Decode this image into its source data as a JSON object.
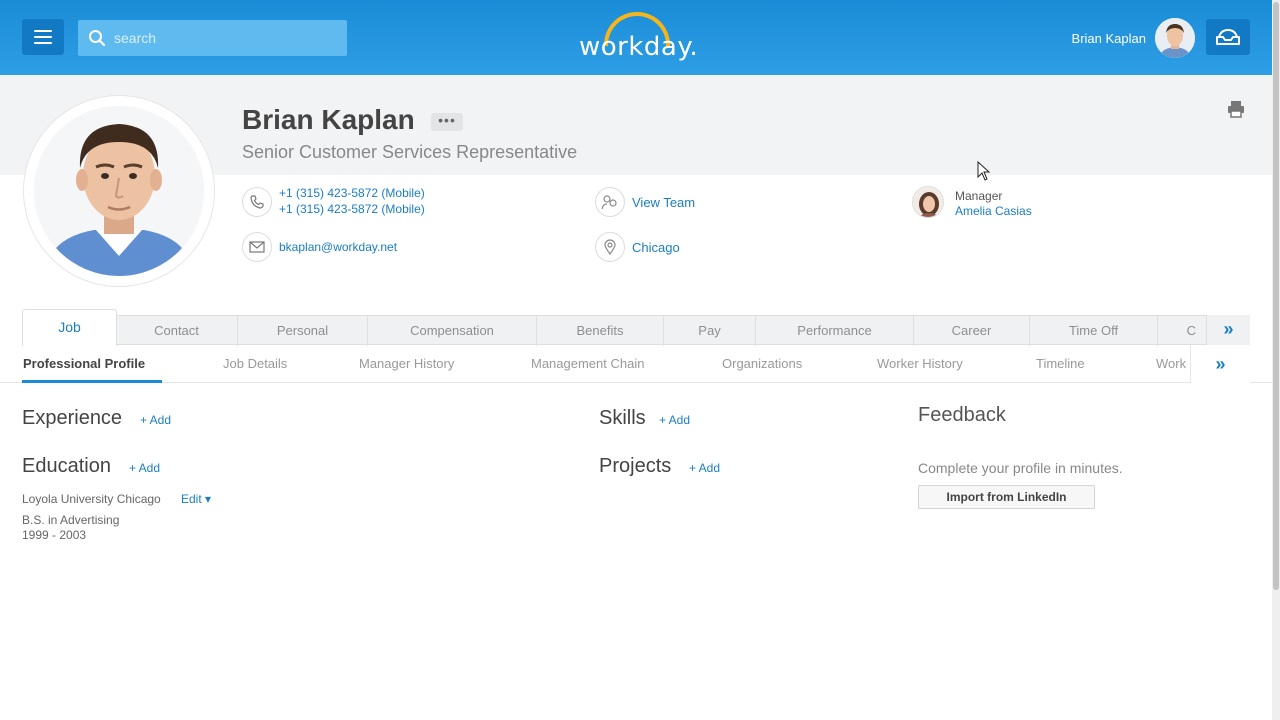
{
  "topbar": {
    "search_placeholder": "search",
    "logo_text": "workday.",
    "user_name": "Brian Kaplan"
  },
  "profile": {
    "name": "Brian Kaplan",
    "more_label": "•••",
    "job_title": "Senior Customer Services Representative",
    "phone_1": "+1 (315) 423-5872 (Mobile)",
    "phone_2": "+1 (315) 423-5872 (Mobile)",
    "email": "bkaplan@workday.net",
    "view_team": "View Team",
    "location": "Chicago",
    "manager_label": "Manager",
    "manager_name": "Amelia Casias"
  },
  "tabs": {
    "active": "Job",
    "items": [
      "Contact",
      "Personal",
      "Compensation",
      "Benefits",
      "Pay",
      "Performance",
      "Career",
      "Time Off",
      "C"
    ],
    "more": "»"
  },
  "subtabs": {
    "items": [
      "Professional Profile",
      "Job Details",
      "Manager History",
      "Management Chain",
      "Organizations",
      "Worker History",
      "Timeline",
      "Work"
    ],
    "more": "»"
  },
  "content": {
    "experience_title": "Experience",
    "education_title": "Education",
    "skills_title": "Skills",
    "projects_title": "Projects",
    "add_label": "+ Add",
    "education": {
      "school": "Loyola University Chicago",
      "edit": "Edit ▾",
      "degree": "B.S. in Advertising",
      "years": "1999 - 2003"
    },
    "feedback_title": "Feedback",
    "feedback_text": "Complete your profile in minutes.",
    "linkedin_button": "Import from LinkedIn"
  },
  "colors": {
    "brand_blue": "#1a8bd6",
    "link_blue": "#1a7ec4",
    "logo_arc": "#f6b51b"
  }
}
